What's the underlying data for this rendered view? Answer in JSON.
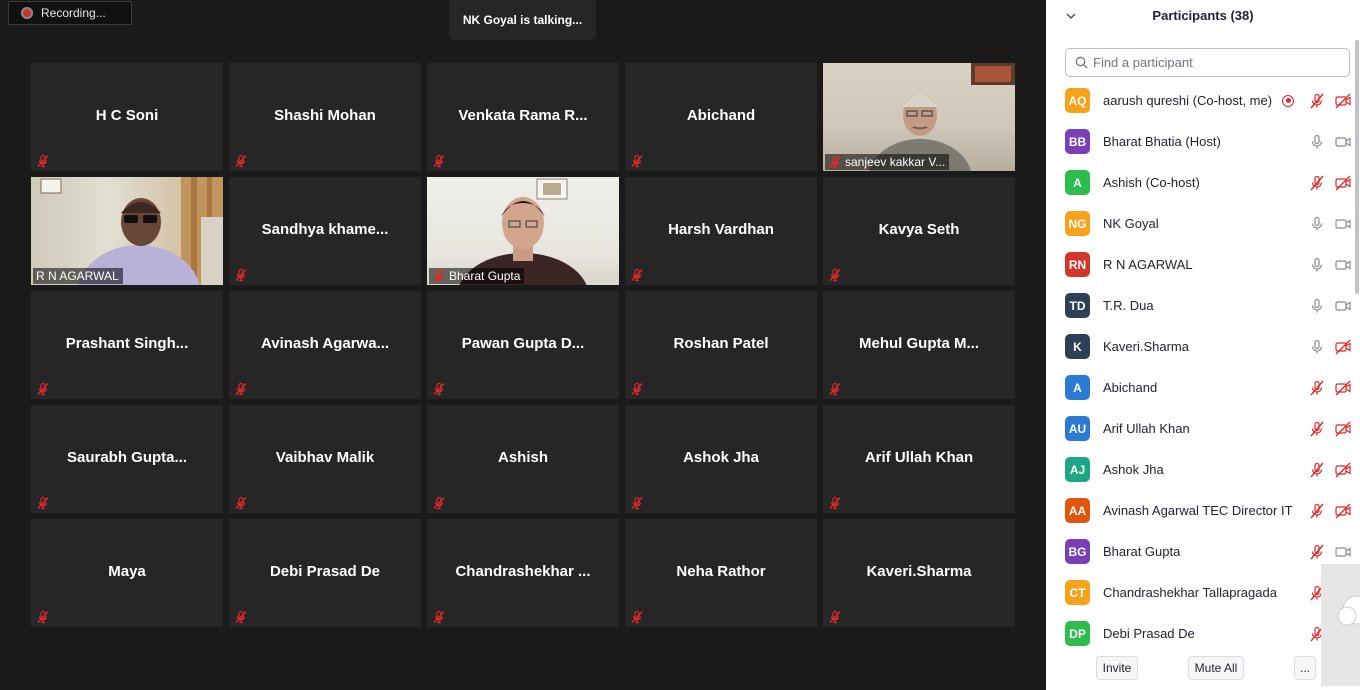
{
  "recording": {
    "label": "Recording..."
  },
  "talking": {
    "label": "NK Goyal is talking..."
  },
  "tiles": [
    {
      "name": "H C Soni",
      "video": false
    },
    {
      "name": "Shashi Mohan",
      "video": false
    },
    {
      "name": "Venkata Rama R...",
      "video": false
    },
    {
      "name": "Abichand",
      "video": false
    },
    {
      "name": "sanjeev kakkar V...",
      "video": true,
      "scene": "kakkar",
      "muted": true
    },
    {
      "name": "R N AGARWAL",
      "video": true,
      "scene": "agarwal",
      "muted": false
    },
    {
      "name": "Sandhya khame...",
      "video": false
    },
    {
      "name": "Bharat Gupta",
      "video": true,
      "scene": "gupta",
      "muted": true
    },
    {
      "name": "Harsh Vardhan",
      "video": false
    },
    {
      "name": "Kavya Seth",
      "video": false
    },
    {
      "name": "Prashant Singh...",
      "video": false
    },
    {
      "name": "Avinash Agarwa...",
      "video": false
    },
    {
      "name": "Pawan Gupta D...",
      "video": false
    },
    {
      "name": "Roshan Patel",
      "video": false
    },
    {
      "name": "Mehul Gupta M...",
      "video": false
    },
    {
      "name": "Saurabh Gupta...",
      "video": false
    },
    {
      "name": "Vaibhav Malik",
      "video": false
    },
    {
      "name": "Ashish",
      "video": false
    },
    {
      "name": "Ashok Jha",
      "video": false
    },
    {
      "name": "Arif Ullah Khan",
      "video": false
    },
    {
      "name": "Maya",
      "video": false
    },
    {
      "name": "Debi Prasad De",
      "video": false
    },
    {
      "name": "Chandrashekhar ...",
      "video": false
    },
    {
      "name": "Neha Rathor",
      "video": false
    },
    {
      "name": "Kaveri.Sharma",
      "video": false
    }
  ],
  "panel": {
    "title": "Participants (38)",
    "search_placeholder": "Find a participant",
    "participants": [
      {
        "initials": "AQ",
        "name": "aarush qureshi (Co-host, me)",
        "color": "#f7a21b",
        "recording": true,
        "mic": "off",
        "video": "off"
      },
      {
        "initials": "BB",
        "name": "Bharat Bhatia (Host)",
        "color": "#7b3fb5",
        "mic": "on",
        "video": "on"
      },
      {
        "initials": "A",
        "name": "Ashish (Co-host)",
        "color": "#2dbd4e",
        "mic": "off",
        "video": "off"
      },
      {
        "initials": "NG",
        "name": "NK Goyal",
        "color": "#f7a21b",
        "mic": "on",
        "video": "on"
      },
      {
        "initials": "RN",
        "name": "R N AGARWAL",
        "color": "#d4352b",
        "mic": "on",
        "video": "on"
      },
      {
        "initials": "TD",
        "name": "T.R. Dua",
        "color": "#2d4058",
        "mic": "on",
        "video": "on"
      },
      {
        "initials": "K",
        "name": "Kaveri.Sharma",
        "color": "#2d4058",
        "mic": "on",
        "video": "off"
      },
      {
        "initials": "A",
        "name": "Abichand",
        "color": "#2b7bd4",
        "mic": "off",
        "video": "off"
      },
      {
        "initials": "AU",
        "name": "Arif Ullah Khan",
        "color": "#2b7bd4",
        "mic": "off",
        "video": "off"
      },
      {
        "initials": "AJ",
        "name": "Ashok Jha",
        "color": "#1aa687",
        "mic": "off",
        "video": "off"
      },
      {
        "initials": "AA",
        "name": "Avinash Agarwal TEC Director IT",
        "color": "#e0560d",
        "mic": "off",
        "video": "off"
      },
      {
        "initials": "BG",
        "name": "Bharat Gupta",
        "color": "#7b3fb5",
        "mic": "off",
        "video": "on"
      },
      {
        "initials": "CT",
        "name": "Chandrashekhar Tallapragada",
        "color": "#f7a21b",
        "mic": "off",
        "video": "none"
      },
      {
        "initials": "DP",
        "name": "Debi Prasad De",
        "color": "#2dbd4e",
        "mic": "off",
        "video": "none"
      }
    ],
    "footer": {
      "invite": "Invite",
      "mute_all": "Mute All",
      "more": "..."
    }
  }
}
